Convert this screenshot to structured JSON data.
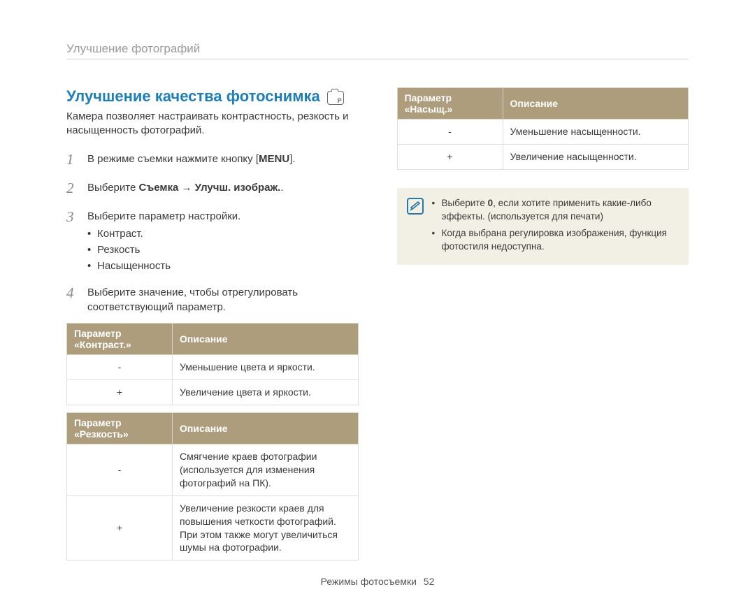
{
  "breadcrumb": "Улучшение фотографий",
  "title": "Улучшение качества фотоснимка",
  "intro": "Камера позволяет настраивать контрастность, резкость и насыщенность фотографий.",
  "steps": {
    "s1_pre": "В режиме съемки нажмите кнопку [",
    "s1_btn": "MENU",
    "s1_post": "].",
    "s2_pre": "Выберите ",
    "s2_bold": "Съемка → Улучш. изображ.",
    "s2_post": ".",
    "s3": "Выберите параметр настройки.",
    "s3_items": [
      "Контраст.",
      "Резкость",
      "Насыщенность"
    ],
    "s4": "Выберите значение, чтобы отрегулировать соответствующий параметр."
  },
  "table_headers": {
    "contrast_param": "Параметр «Контраст.»",
    "sharpness_param": "Параметр «Резкость»",
    "saturation_param": "Параметр «Насыщ.»",
    "desc": "Описание"
  },
  "contrast": {
    "minus": {
      "sym": "-",
      "desc": "Уменьшение цвета и яркости."
    },
    "plus": {
      "sym": "+",
      "desc": "Увеличение цвета и яркости."
    }
  },
  "sharpness": {
    "minus": {
      "sym": "-",
      "desc": "Смягчение краев фотографии (используется для изменения фотографий на ПК)."
    },
    "plus": {
      "sym": "+",
      "desc": "Увеличение резкости краев для повышения четкости фотографий. При этом также могут увеличиться шумы на фотографии."
    }
  },
  "saturation": {
    "minus": {
      "sym": "-",
      "desc": "Уменьшение насыщенности."
    },
    "plus": {
      "sym": "+",
      "desc": "Увеличение насыщенности."
    }
  },
  "notes": {
    "n1_a": "Выберите ",
    "n1_b": "0",
    "n1_c": ", если хотите применить какие-либо эффекты. (используется для печати)",
    "n2": "Когда выбрана регулировка изображения, функция фотостиля недоступна."
  },
  "footer_label": "Режимы фотосъемки",
  "page_number": "52"
}
